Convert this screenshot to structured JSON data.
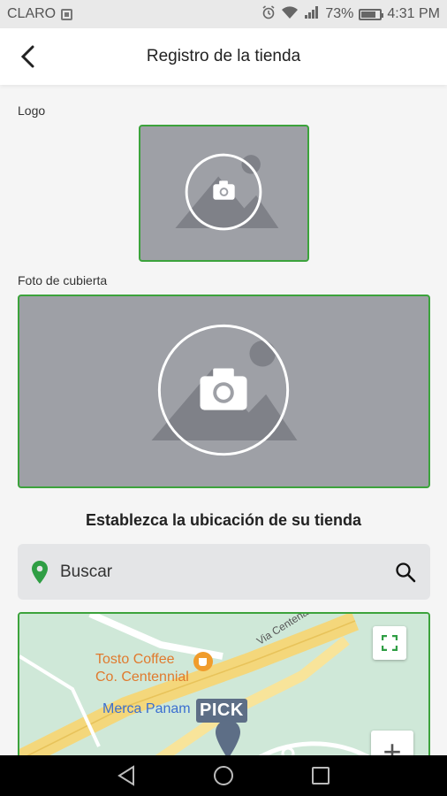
{
  "status_bar": {
    "carrier": "CLARO",
    "battery": "73%",
    "time": "4:31 PM"
  },
  "header": {
    "title": "Registro de la tienda"
  },
  "form": {
    "logo_label": "Logo",
    "cover_label": "Foto de cubierta",
    "location_title": "Establezca la ubicación de su tienda",
    "search_placeholder": "Buscar"
  },
  "map": {
    "poi_coffee_line1": "Tosto Coffee",
    "poi_coffee_line2": "Co. Centennial",
    "poi_merca": "Merca Panam",
    "road": "Via Centenario",
    "pin_label": "PICK",
    "zoom_in": "+"
  },
  "colors": {
    "accent_green": "#3ca33c",
    "placeholder_gray": "#9ea0a6",
    "map_green": "#cfe8d8"
  }
}
